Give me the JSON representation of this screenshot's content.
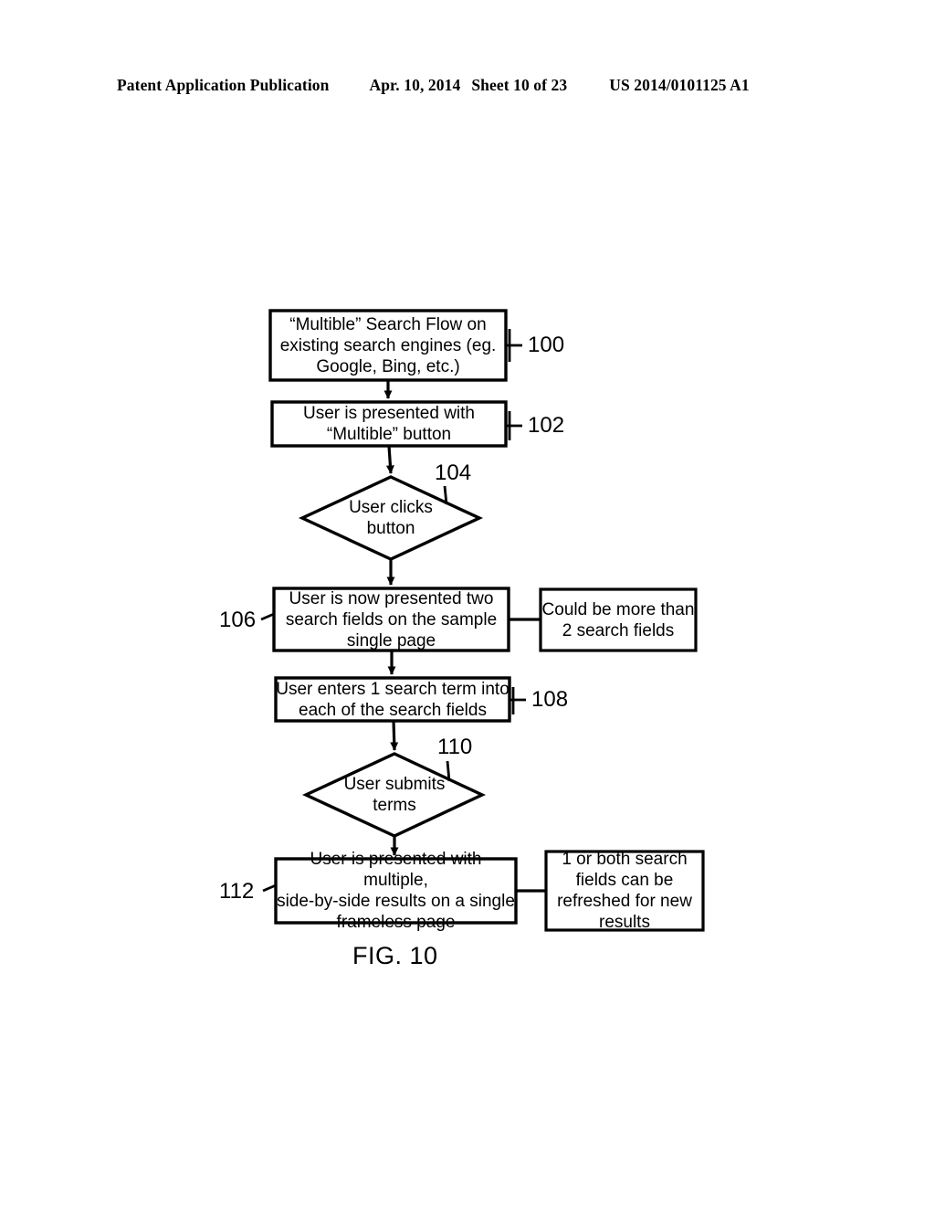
{
  "header": {
    "publication": "Patent Application Publication",
    "date": "Apr. 10, 2014",
    "sheet": "Sheet 10 of 23",
    "patent_number": "US 2014/0101125 A1"
  },
  "figure": {
    "caption": "FIG. 10",
    "nodes": {
      "n100": {
        "ref": "100",
        "shape": "process",
        "text": "“Multible” Search Flow on\nexisting search engines (eg.\nGoogle, Bing, etc.)"
      },
      "n102": {
        "ref": "102",
        "shape": "process",
        "text": "User is presented with\n“Multible” button"
      },
      "n104": {
        "ref": "104",
        "shape": "decision",
        "text": "User clicks\nbutton"
      },
      "n106": {
        "ref": "106",
        "shape": "process",
        "text": "User is now presented two\nsearch fields on the sample\nsingle page"
      },
      "n108": {
        "ref": "108",
        "shape": "process",
        "text": "User enters 1 search term into\neach of the search fields"
      },
      "n110": {
        "ref": "110",
        "shape": "decision",
        "text": "User submits\nterms"
      },
      "n112": {
        "ref": "112",
        "shape": "process",
        "text": "User is presented with multiple,\nside-by-side results on a single\nframeless page"
      },
      "noteA": {
        "shape": "annotation",
        "text": "Could be more than\n2 search fields"
      },
      "noteB": {
        "shape": "annotation",
        "text": "1 or both search\nfields can be\nrefreshed for new\nresults"
      }
    }
  },
  "colors": {
    "ink": "#000000",
    "paper": "#ffffff"
  }
}
